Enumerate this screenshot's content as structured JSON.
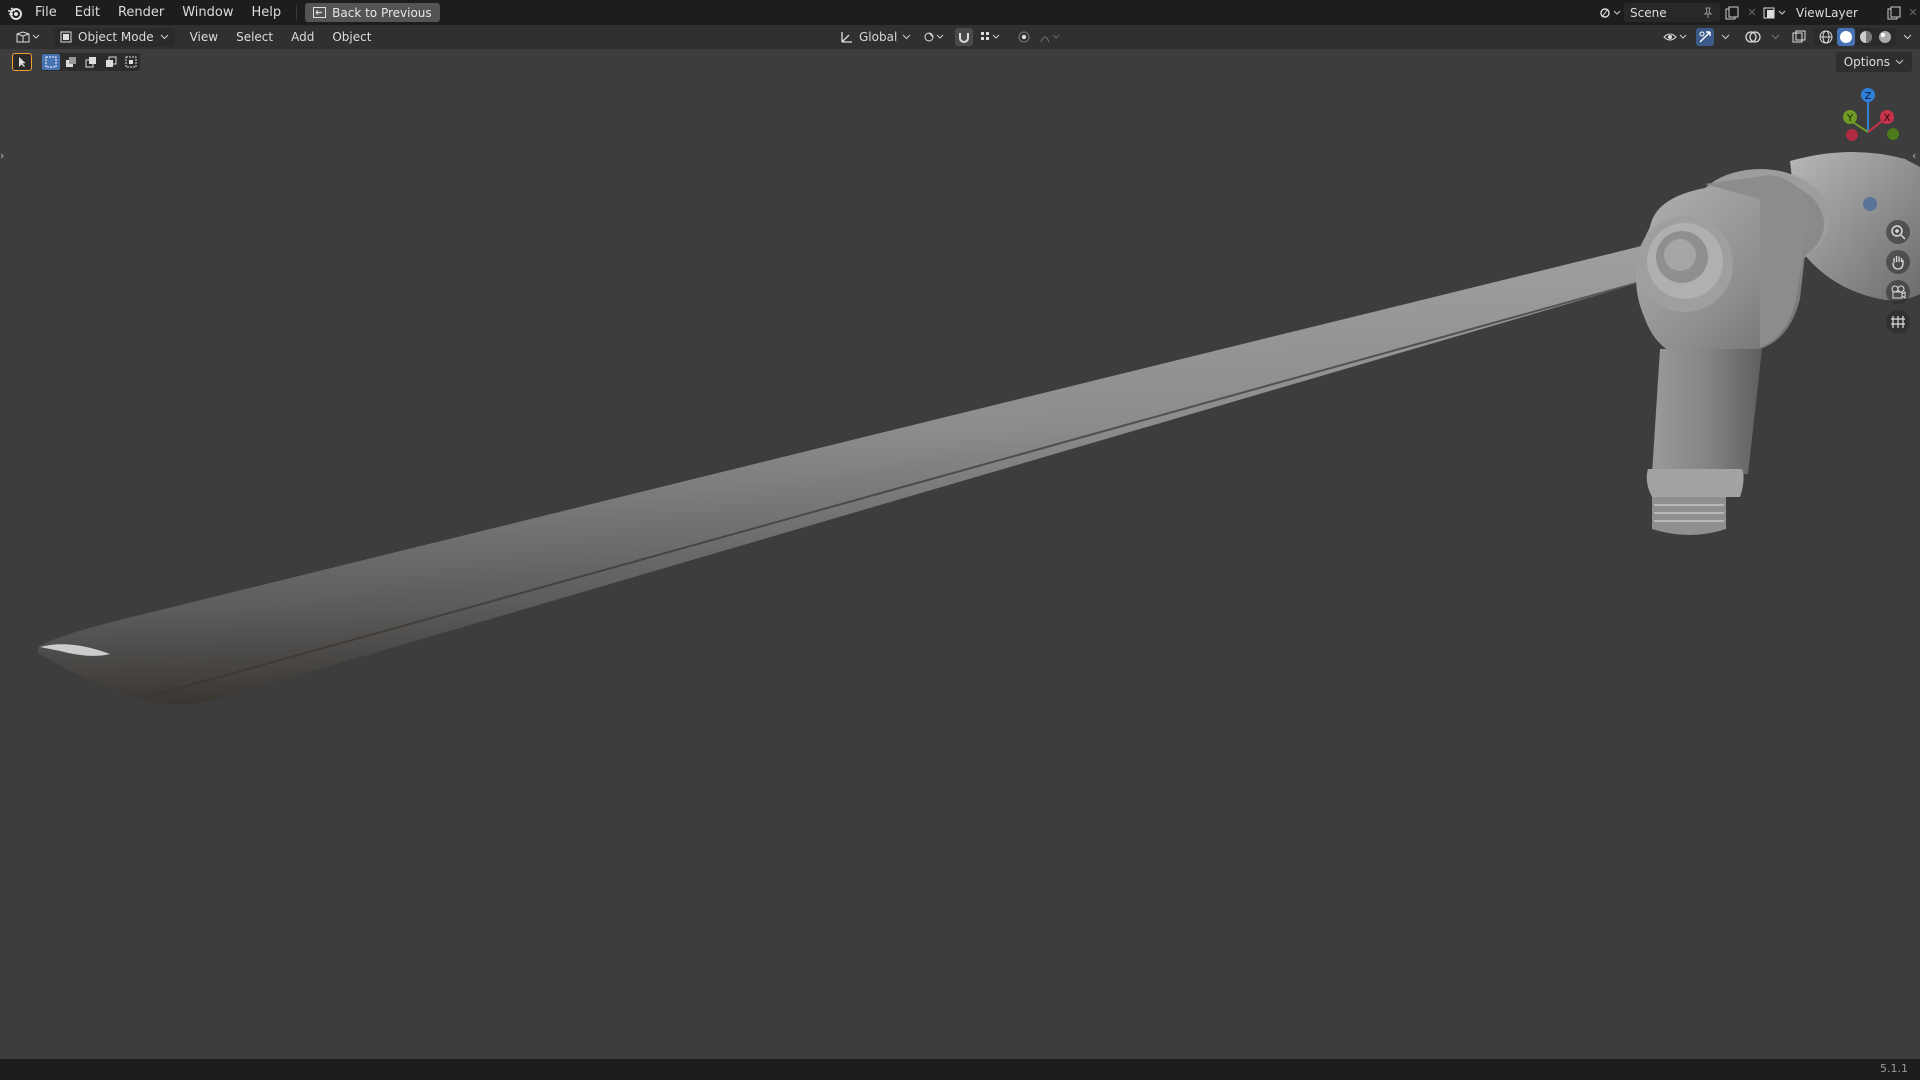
{
  "topbar": {
    "menu": [
      "File",
      "Edit",
      "Render",
      "Window",
      "Help"
    ],
    "back_button": "Back to Previous",
    "scene_label": "Scene",
    "viewlayer_label": "ViewLayer"
  },
  "header": {
    "mode": "Object Mode",
    "menus": [
      "View",
      "Select",
      "Add",
      "Object"
    ],
    "transform_orientation": "Global"
  },
  "toolbar": {
    "options_label": "Options"
  },
  "gizmo": {
    "axes": [
      "Z",
      "Y",
      "X"
    ],
    "colors": {
      "x": "#c8324b",
      "y": "#6e9b25",
      "z": "#2f7fd8"
    }
  },
  "nav_icons": [
    "zoom-icon",
    "pan-hand-icon",
    "camera-icon",
    "grid-icon"
  ],
  "status": {
    "version": "5.1.1"
  }
}
